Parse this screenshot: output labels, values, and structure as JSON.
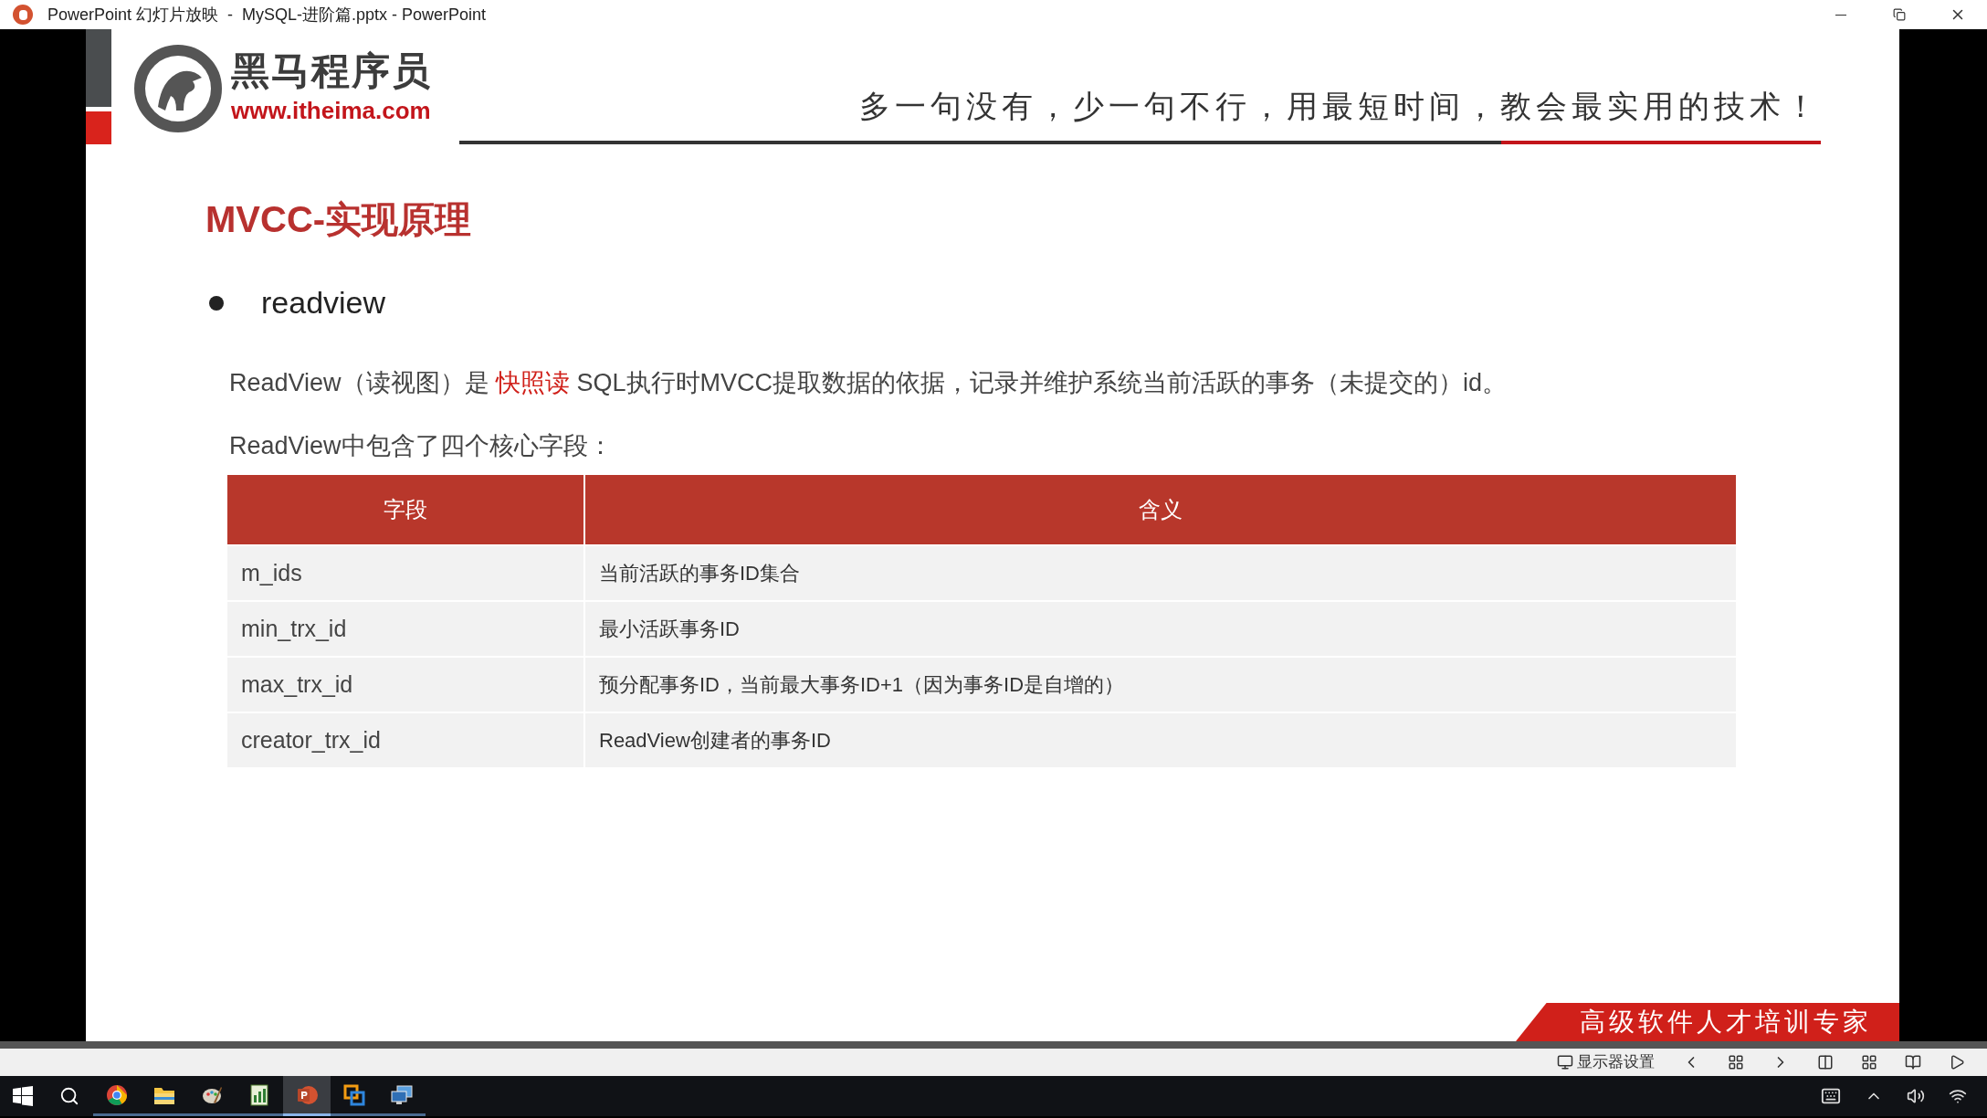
{
  "window": {
    "title": "PowerPoint 幻灯片放映  -  MySQL-进阶篇.pptx - PowerPoint"
  },
  "slide": {
    "brand_name": "黑马程序员",
    "brand_url": "www.itheima.com",
    "slogan": "多一句没有，少一句不行，用最短时间，教会最实用的技术！",
    "title": "MVCC-实现原理",
    "bullet": "readview",
    "paragraph": [
      {
        "kind": "plain",
        "text": "ReadView（读视图）是 "
      },
      {
        "kind": "highlight",
        "text": "快照读"
      },
      {
        "kind": "plain",
        "text": " SQL执行时MVCC提取数据的依据，记录并维护系统当前活跃的事务（未提交的）id。"
      }
    ],
    "table_intro": "ReadView中包含了四个核心字段：",
    "table": {
      "columns": [
        "字段",
        "含义"
      ],
      "rows": [
        {
          "field": "m_ids",
          "meaning": "当前活跃的事务ID集合"
        },
        {
          "field": "min_trx_id",
          "meaning": "最小活跃事务ID"
        },
        {
          "field": "max_trx_id",
          "meaning": "预分配事务ID，当前最大事务ID+1（因为事务ID是自增的）"
        },
        {
          "field": "creator_trx_id",
          "meaning": "ReadView创建者的事务ID"
        }
      ]
    },
    "banner": "高级软件人才培训专家"
  },
  "slideshow_toolbar": {
    "monitor_settings": "显示器设置"
  },
  "taskbar": {
    "apps": [
      {
        "kind": "chrome",
        "selected": false
      },
      {
        "kind": "folder",
        "selected": false
      },
      {
        "kind": "paint",
        "selected": false
      },
      {
        "kind": "chart",
        "selected": false
      },
      {
        "kind": "powerpoint",
        "selected": true
      },
      {
        "kind": "boxes",
        "selected": false
      },
      {
        "kind": "remote",
        "selected": false
      }
    ]
  }
}
